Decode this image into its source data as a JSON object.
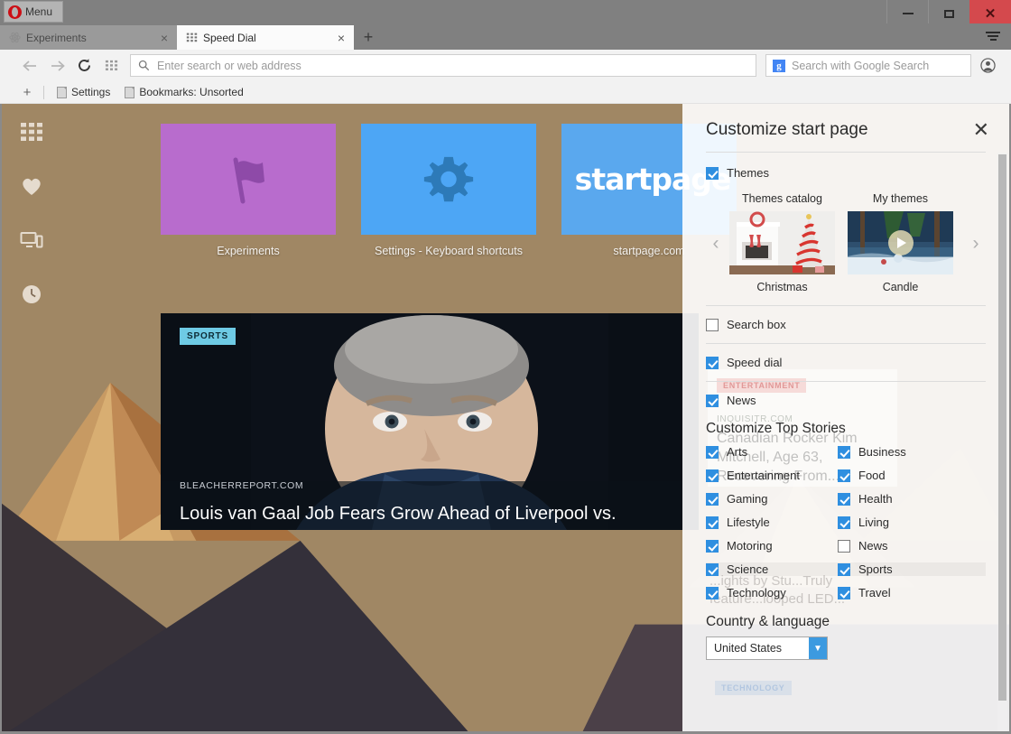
{
  "window": {
    "menu_button": "Menu",
    "controls": {
      "minimize": "minimize-icon",
      "maximize": "maximize-icon",
      "close": "close-icon"
    },
    "tab_menu": "tab-menu-icon"
  },
  "tabs": [
    {
      "title": "Experiments",
      "favicon": "atom-icon",
      "active": false,
      "close": "×"
    },
    {
      "title": "Speed Dial",
      "favicon": "grid-icon",
      "active": true,
      "close": "×"
    }
  ],
  "new_tab_label": "+",
  "navbar": {
    "back": "back-arrow-icon",
    "forward": "forward-arrow-icon",
    "reload": "reload-icon",
    "speeddial": "speed-dial-grid-icon",
    "address_placeholder": "Enter search or web address",
    "address_value": "",
    "search_placeholder": "Search with Google Search",
    "search_engine_glyph": "g",
    "profile": "profile-icon"
  },
  "bookmarks_bar": {
    "add_label": "+",
    "items": [
      {
        "label": "Settings"
      },
      {
        "label": "Bookmarks: Unsorted"
      }
    ]
  },
  "sidebar": {
    "items": [
      {
        "name": "speed-dial",
        "icon": "grid-icon"
      },
      {
        "name": "bookmarks",
        "icon": "heart-icon"
      },
      {
        "name": "my-flow",
        "icon": "devices-icon"
      },
      {
        "name": "history",
        "icon": "clock-icon"
      }
    ]
  },
  "speed_dial": {
    "tiles": [
      {
        "label": "Experiments",
        "icon": "flag-icon",
        "color": "#b86ccd"
      },
      {
        "label": "Settings - Keyboard shortcuts",
        "icon": "gear-icon",
        "color": "#4da6f5"
      },
      {
        "label": "startpage.com",
        "icon": "startpage-wordmark",
        "wordmark": "startpage",
        "color": "#5aa8ee"
      }
    ]
  },
  "news_card": {
    "category": "SPORTS",
    "source": "BLEACHERREPORT.COM",
    "headline": "Louis van Gaal Job Fears Grow Ahead of Liverpool vs."
  },
  "ghost_news": {
    "card1": {
      "category": "ENTERTAINMENT",
      "source": "INQUISITR.COM",
      "headline": "Canadian Rocker Kim Mitchell, Age 63, Recovering From..."
    },
    "card2": {
      "category": "TECHNOLOGY",
      "headline": "...ights by Stu...Truly feature...looped LED..."
    }
  },
  "panel": {
    "title": "Customize start page",
    "close": "✕",
    "themes": {
      "label": "Themes",
      "checked": true
    },
    "carousel": {
      "prev": "‹",
      "next": "›",
      "tabs": [
        {
          "label": "Themes catalog",
          "active": true
        },
        {
          "label": "My themes",
          "active": false
        }
      ],
      "items": [
        {
          "name": "Christmas",
          "thumb": "christmas-theme-thumbnail",
          "has_play": false
        },
        {
          "name": "Candle",
          "thumb": "candle-theme-thumbnail",
          "has_play": true
        }
      ]
    },
    "toggles": [
      {
        "label": "Search box",
        "checked": false
      },
      {
        "label": "Speed dial",
        "checked": true
      },
      {
        "label": "News",
        "checked": true
      }
    ],
    "top_stories": {
      "title": "Customize Top Stories",
      "categories": [
        {
          "label": "Arts",
          "checked": true
        },
        {
          "label": "Business",
          "checked": true
        },
        {
          "label": "Entertainment",
          "checked": true
        },
        {
          "label": "Food",
          "checked": true
        },
        {
          "label": "Gaming",
          "checked": true
        },
        {
          "label": "Health",
          "checked": true
        },
        {
          "label": "Lifestyle",
          "checked": true
        },
        {
          "label": "Living",
          "checked": true
        },
        {
          "label": "Motoring",
          "checked": true
        },
        {
          "label": "News",
          "checked": false
        },
        {
          "label": "Science",
          "checked": true
        },
        {
          "label": "Sports",
          "checked": true
        },
        {
          "label": "Technology",
          "checked": true
        },
        {
          "label": "Travel",
          "checked": true
        }
      ]
    },
    "country_language": {
      "title": "Country & language",
      "selected": "United States",
      "caret": "⌄"
    }
  },
  "colors": {
    "accent_blue": "#2f8fe0",
    "close_red": "#d4494d",
    "tile_purple": "#b86ccd",
    "tile_blue": "#4da6f5",
    "sports_badge": "#6ecae4"
  }
}
